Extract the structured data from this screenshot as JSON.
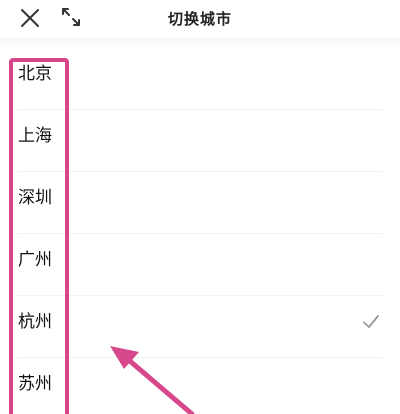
{
  "header": {
    "title": "切换城市",
    "close_icon": "close-icon",
    "expand_icon": "expand-icon"
  },
  "cities": [
    {
      "label": "北京",
      "selected": false
    },
    {
      "label": "上海",
      "selected": false
    },
    {
      "label": "深圳",
      "selected": false
    },
    {
      "label": "广州",
      "selected": false
    },
    {
      "label": "杭州",
      "selected": true
    },
    {
      "label": "苏州",
      "selected": false
    }
  ],
  "colors": {
    "highlight": "#d6488b",
    "check": "#999999"
  }
}
